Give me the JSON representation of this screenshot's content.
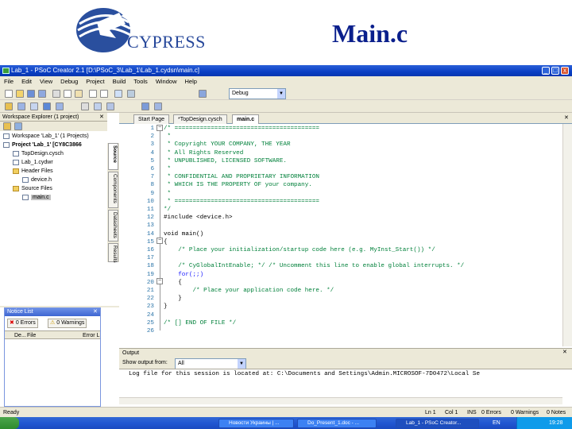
{
  "slide": {
    "logo_text": "CYPRESS",
    "title": "Main.c"
  },
  "window": {
    "title": "Lab_1 - PSoC Creator 2.1  [D:\\PSoC_3\\Lab_1\\Lab_1.cydsn\\main.c]",
    "min": "_",
    "max": "□",
    "close": "x"
  },
  "menu": [
    "File",
    "Edit",
    "View",
    "Debug",
    "Project",
    "Build",
    "Tools",
    "Window",
    "Help"
  ],
  "toolbar": {
    "config": "Debug"
  },
  "workspace": {
    "header": "Workspace Explorer (1 project)",
    "tree": [
      "Workspace 'Lab_1' (1 Projects)",
      "Project 'Lab_1' [CY8C3866",
      "TopDesign.cysch",
      "Lab_1.cydwr",
      "Header Files",
      "device.h",
      "Source Files",
      "main.c"
    ],
    "vtabs": [
      "Source",
      "Components",
      "Datasheets",
      "Results"
    ]
  },
  "notice": {
    "title": "Notice List",
    "errors": "0 Errors",
    "warnings": "0 Warnings",
    "col1": "De...",
    "col2": "File",
    "col3": "Error L"
  },
  "editor": {
    "tabs": [
      "Start Page",
      "*TopDesign.cysch",
      "main.c"
    ],
    "lines": [
      "1",
      "2",
      "3",
      "4",
      "5",
      "6",
      "7",
      "8",
      "9",
      "10",
      "11",
      "12",
      "13",
      "14",
      "15",
      "16",
      "17",
      "18",
      "19",
      "20",
      "21",
      "22",
      "23",
      "24",
      "25",
      "26"
    ],
    "code": [
      "/* ========================================",
      " *",
      " * Copyright YOUR COMPANY, THE YEAR",
      " * All Rights Reserved",
      " * UNPUBLISHED, LICENSED SOFTWARE.",
      " *",
      " * CONFIDENTIAL AND PROPRIETARY INFORMATION",
      " * WHICH IS THE PROPERTY OF your company.",
      " *",
      " * ========================================",
      "*/",
      "#include <device.h>",
      "",
      "void main()",
      "{",
      "    /* Place your initialization/startup code here (e.g. MyInst_Start()) */",
      "",
      "    /* CyGlobalIntEnable; */ /* Uncomment this line to enable global interrupts. */",
      "    for(;;)",
      "    {",
      "        /* Place your application code here. */",
      "    }",
      "}",
      "",
      "/* [] END OF FILE */",
      ""
    ]
  },
  "output": {
    "header": "Output",
    "show_label": "Show output from:",
    "show_value": "All",
    "log": "Log file for this session is located at: C:\\Documents and Settings\\Admin.MICROSOF-7D0472\\Local Se"
  },
  "status": {
    "ready": "Ready",
    "ln": "Ln 1",
    "col": "Col 1",
    "ins": "INS",
    "errors": "0 Errors",
    "warnings": "0 Warnings",
    "notes": "0 Notes"
  },
  "taskbar": {
    "items": [
      "Новости Украины | ...",
      "Do_Present_1.doc - ...",
      "Lab_1 - PSoC Creator..."
    ],
    "lang": "EN",
    "time": "19:28"
  }
}
